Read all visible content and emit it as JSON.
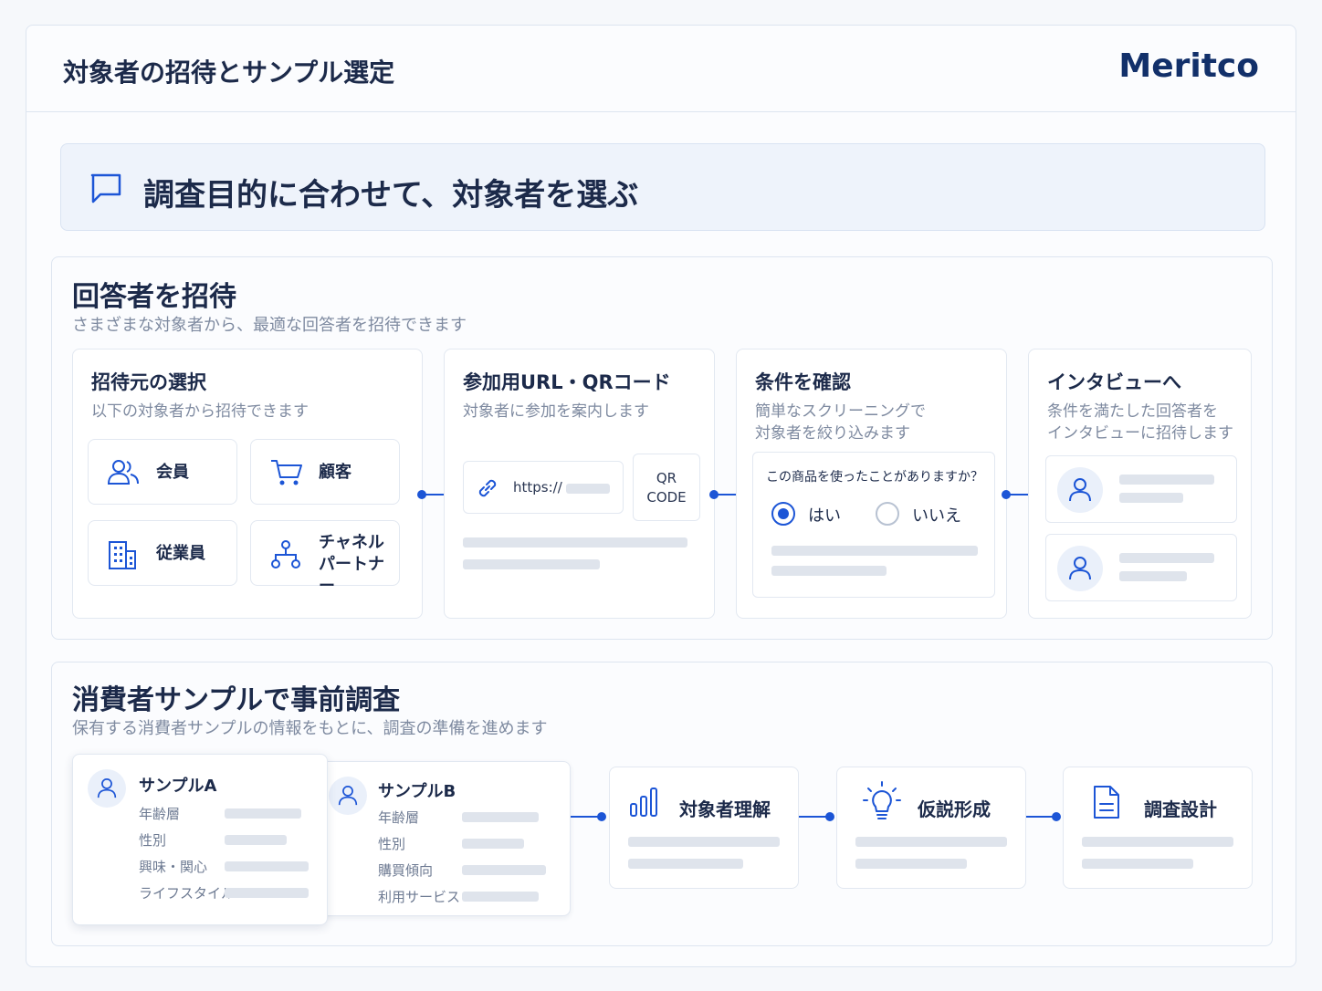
{
  "header": {
    "title": "対象者の招待とサンプル選定",
    "brand": "Meritco"
  },
  "banner": {
    "text": "調査目的に合わせて、対象者を選ぶ",
    "icon": "chat-bubble-icon"
  },
  "invite": {
    "title": "回答者を招待",
    "subtitle": "さまざまな対象者から、最適な回答者を招待できます",
    "source": {
      "title": "招待元の選択",
      "subtitle": "以下の対象者から招待できます",
      "options": [
        {
          "label": "会員",
          "icon": "users-icon"
        },
        {
          "label": "顧客",
          "icon": "cart-icon"
        },
        {
          "label": "従業員",
          "icon": "building-icon"
        },
        {
          "label": "チャネル",
          "label2": "パートナー",
          "icon": "network-icon"
        }
      ]
    },
    "url": {
      "title": "参加用URL・QRコード",
      "subtitle": "対象者に参加を案内します",
      "url_text": "https://",
      "qr_line1": "QR",
      "qr_line2": "CODE"
    },
    "screen": {
      "title": "条件を確認",
      "subtitle_line1": "簡単なスクリーニングで",
      "subtitle_line2": "対象者を絞り込みます",
      "question": "この商品を使ったことがありますか？",
      "yes": "はい",
      "no": "いいえ",
      "selected": "はい"
    },
    "interview": {
      "title": "インタビューへ",
      "subtitle_line1": "条件を満たした回答者を",
      "subtitle_line2": "インタビューに招待します"
    }
  },
  "sample": {
    "title": "消費者サンプルで事前調査",
    "subtitle": "保有する消費者サンプルの情報をもとに、調査の準備を進めます",
    "sample_a": {
      "title": "サンプルA",
      "fields": [
        "年齢層",
        "性別",
        "興味・関心",
        "ライフスタイル"
      ]
    },
    "sample_b": {
      "title": "サンプルB",
      "fields": [
        "年齢層",
        "性別",
        "購買傾向",
        "利用サービス"
      ]
    },
    "stages": [
      {
        "label": "対象者理解",
        "icon": "bar-chart-icon"
      },
      {
        "label": "仮説形成",
        "icon": "lightbulb-icon"
      },
      {
        "label": "調査設計",
        "icon": "document-icon"
      }
    ]
  },
  "colors": {
    "accent": "#1c55d6",
    "navy": "#1c2a4a",
    "brand": "#12306a"
  }
}
